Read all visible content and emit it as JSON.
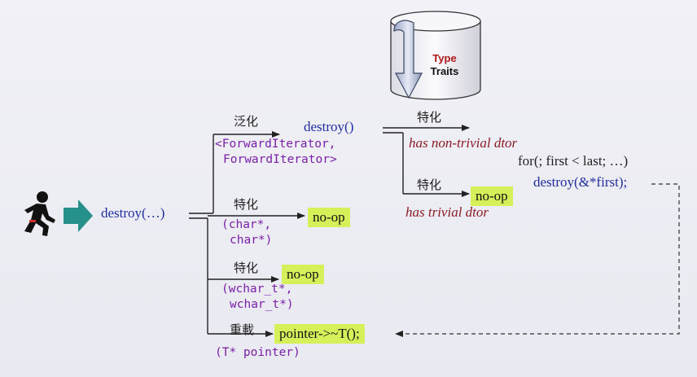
{
  "traits": {
    "line1": "Type",
    "line2": "Traits"
  },
  "entry_call": "destroy(…)",
  "generic": {
    "tag": "泛化",
    "func": "destroy()",
    "params": [
      "<ForwardIterator,",
      "ForwardIterator>"
    ],
    "nontrivial": {
      "tag": "特化",
      "label": "has non-trivial dtor"
    },
    "trivial": {
      "tag": "特化",
      "result": "no-op",
      "label": "has trivial dtor"
    },
    "loop": [
      "for(; first < last; …)",
      "destroy(&*first);"
    ]
  },
  "char_spec": {
    "tag": "特化",
    "params": [
      "(char*,",
      "char*)"
    ],
    "result": "no-op"
  },
  "wchar_spec": {
    "tag": "特化",
    "params": [
      "(wchar_t*,",
      "wchar_t*)"
    ],
    "result": "no-op"
  },
  "overload": {
    "tag": "重載",
    "params": "(T* pointer)",
    "result": "pointer->~T();"
  },
  "colors": {
    "highlight": "#d6f05a",
    "mono": "#7a1fa8",
    "italic": "#8a1a24",
    "arrow": "#26908a"
  }
}
